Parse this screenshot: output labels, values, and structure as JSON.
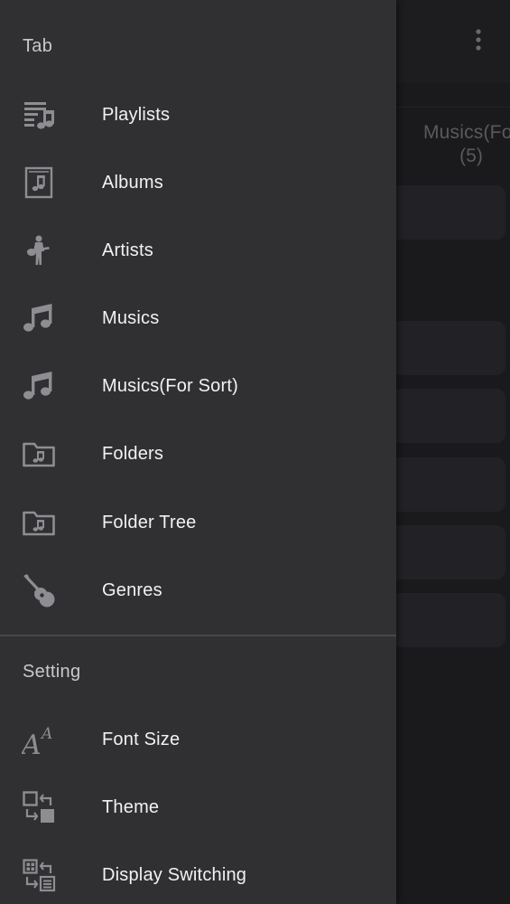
{
  "background": {
    "tab_label": "Musics(For S",
    "tab_count": "(5)"
  },
  "drawer": {
    "tab_section": {
      "header": "Tab",
      "items": [
        {
          "label": "Playlists",
          "icon": "playlist-icon"
        },
        {
          "label": "Albums",
          "icon": "album-icon"
        },
        {
          "label": "Artists",
          "icon": "artist-icon"
        },
        {
          "label": "Musics",
          "icon": "music-note-icon"
        },
        {
          "label": "Musics(For Sort)",
          "icon": "music-note-icon"
        },
        {
          "label": "Folders",
          "icon": "music-folder-icon"
        },
        {
          "label": "Folder Tree",
          "icon": "music-folder-icon"
        },
        {
          "label": "Genres",
          "icon": "guitar-icon"
        }
      ]
    },
    "setting_section": {
      "header": "Setting",
      "items": [
        {
          "label": "Font Size",
          "icon": "font-size-icon"
        },
        {
          "label": "Theme",
          "icon": "theme-swap-icon"
        },
        {
          "label": "Display Switching",
          "icon": "display-switch-icon"
        }
      ]
    }
  },
  "colors": {
    "drawer_bg": "#303033",
    "icon_gray": "#8e8e92",
    "label_white": "#f2f2f4",
    "header_gray": "#c9c9cc",
    "backdrop": "#1a191c"
  }
}
